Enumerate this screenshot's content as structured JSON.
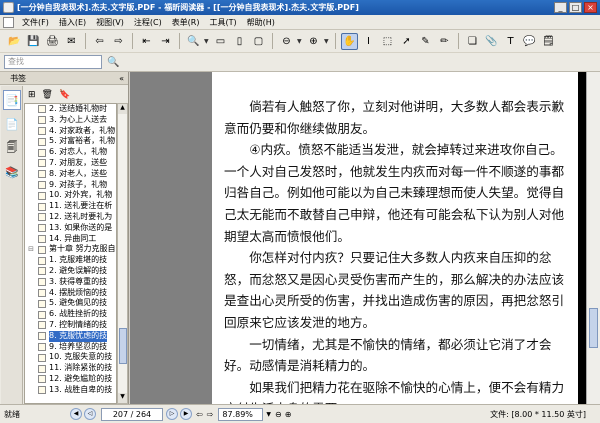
{
  "window": {
    "title": "[一分钟自我表现术].杰夫.文字版.PDF - 福昕阅读器 - [[一分钟自我表现术].杰夫.文字版.PDF]"
  },
  "menu": [
    "文件(F)",
    "插入(E)",
    "视图(V)",
    "注程(C)",
    "表单(R)",
    "工具(T)",
    "帮助(H)"
  ],
  "search": {
    "placeholder": "查找"
  },
  "sidebar": {
    "header": "书签",
    "collapse": "«",
    "bookmarks": [
      {
        "label": "2. 送结婚礼物时",
        "chapter": false
      },
      {
        "label": "3. 为心上人送去",
        "chapter": false
      },
      {
        "label": "4. 对家政者，礼物",
        "chapter": false
      },
      {
        "label": "5. 对富裕者，礼物",
        "chapter": false
      },
      {
        "label": "6. 对恋人，礼物",
        "chapter": false
      },
      {
        "label": "7. 对朋友，送些",
        "chapter": false
      },
      {
        "label": "8. 对老人，送些",
        "chapter": false
      },
      {
        "label": "9. 对孩子，礼物",
        "chapter": false
      },
      {
        "label": "10. 对外宾，礼物",
        "chapter": false
      },
      {
        "label": "11. 送礼要注在析",
        "chapter": false
      },
      {
        "label": "12. 送礼时要礼为",
        "chapter": false
      },
      {
        "label": "13. 如果你送的是",
        "chapter": false
      },
      {
        "label": "14. 异曲同工",
        "chapter": false
      },
      {
        "label": "第十章  努力克服自",
        "chapter": true
      },
      {
        "label": "1. 克服难堪的技",
        "chapter": false
      },
      {
        "label": "2. 避免误解的技",
        "chapter": false
      },
      {
        "label": "3. 获得尊重的技",
        "chapter": false
      },
      {
        "label": "4. 摆脱烦恼的技",
        "chapter": false
      },
      {
        "label": "5. 避免偏见的技",
        "chapter": false
      },
      {
        "label": "6. 战胜挫折的技",
        "chapter": false
      },
      {
        "label": "7. 控制情绪的技",
        "chapter": false
      },
      {
        "label": "8. 克服忧虑的技",
        "chapter": false
      },
      {
        "label": "9. 培养坚忍的技",
        "chapter": false
      },
      {
        "label": "10. 克服失意的技",
        "chapter": false
      },
      {
        "label": "11. 消除紧张的技",
        "chapter": false
      },
      {
        "label": "12. 避免尴尬的技",
        "chapter": false
      },
      {
        "label": "13. 战胜自卑的技",
        "chapter": false
      }
    ]
  },
  "document": {
    "paragraphs": [
      {
        "text": "倘若有人触怒了你，立刻对他讲明，大多数人都会表示歉意而仍要和你继续做朋友。",
        "indent": true
      },
      {
        "text": "④内疚。愤怒不能适当发泄，就会掉转过来进攻你自己。一个人对自己发怒时，他就发生内疚而对每一件不顺遂的事都归咎自己。例如他可能以为自己未臻理想而使人失望。觉得自己太无能而不敢替自己申辩，他还有可能会私下认为别人对他期望太高而愤恨他们。",
        "indent": true
      },
      {
        "text": "你怎样对付内疚？只要记住大多数人内疚来自压抑的忿怒，而忿怒又是因心灵受伤害而产生的，那么解决的办法应该是查出心灵所受的伤害，并找出造成伤害的原因，再把忿怒引回原来它应该发泄的地方。",
        "indent": true
      },
      {
        "text": "一切情绪，尤其是不愉快的情绪，都必须让它消了才会好。动感情是消耗精力的。",
        "indent": true
      },
      {
        "text": "如果我们把精力花在驱除不愉快的心情上，便不会有精力应付生活本身的需要。",
        "indent": true
      }
    ]
  },
  "status": {
    "ready": "就绪",
    "page": "207 / 264",
    "zoom": "87.89%",
    "filesize": "文件: [8.00 * 11.50 英寸]"
  }
}
